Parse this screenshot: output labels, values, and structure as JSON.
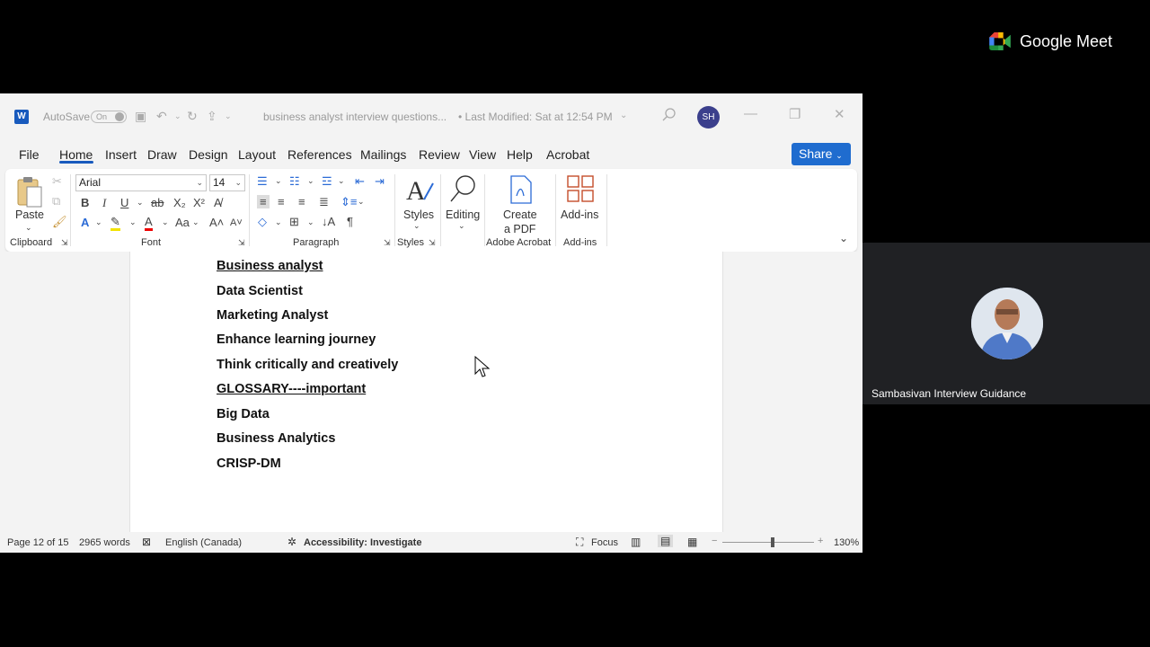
{
  "titlebar": {
    "autosave_label": "AutoSave",
    "autosave_state": "On",
    "doc_title": "business analyst interview questions...",
    "last_modified": "• Last Modified: Sat at 12:54 PM",
    "user_initials": "SH"
  },
  "menu": {
    "tabs": [
      "File",
      "Home",
      "Insert",
      "Draw",
      "Design",
      "Layout",
      "References",
      "Mailings",
      "Review",
      "View",
      "Help",
      "Acrobat"
    ],
    "active": "Home",
    "share_label": "Share"
  },
  "ribbon": {
    "paste_label": "Paste",
    "font_name": "Arial",
    "font_size": "14",
    "styles_label": "Styles",
    "editing_label": "Editing",
    "create_pdf_line1": "Create",
    "create_pdf_line2": "a PDF",
    "addins_label": "Add-ins",
    "groups": {
      "clipboard": "Clipboard",
      "font": "Font",
      "paragraph": "Paragraph",
      "styles": "Styles",
      "adobe": "Adobe Acrobat",
      "addins": "Add-ins"
    }
  },
  "document": {
    "lines": [
      {
        "text": "Business  analyst",
        "underline": true
      },
      {
        "text": "Data Scientist",
        "underline": false
      },
      {
        "text": "Marketing Analyst",
        "underline": false
      },
      {
        "text": "Enhance learning journey",
        "underline": false
      },
      {
        "text": "Think critically and creatively",
        "underline": false
      },
      {
        "text": "GLOSSARY----important",
        "underline": true
      },
      {
        "text": "Big Data",
        "underline": false
      },
      {
        "text": "Business Analytics",
        "underline": false
      },
      {
        "text": "CRISP-DM",
        "underline": false
      }
    ]
  },
  "status": {
    "page": "Page 12 of 15",
    "words": "2965 words",
    "language": "English (Canada)",
    "accessibility": "Accessibility: Investigate",
    "focus": "Focus",
    "zoom": "130%",
    "zoom_slider_fraction": 0.55
  },
  "meet": {
    "brand": "Google Meet",
    "participant_name": "Sambasivan Interview Guidance"
  },
  "colors": {
    "word_blue": "#185abd",
    "share_blue": "#1f6ccf",
    "avatar_bg": "#3b3f8c"
  }
}
